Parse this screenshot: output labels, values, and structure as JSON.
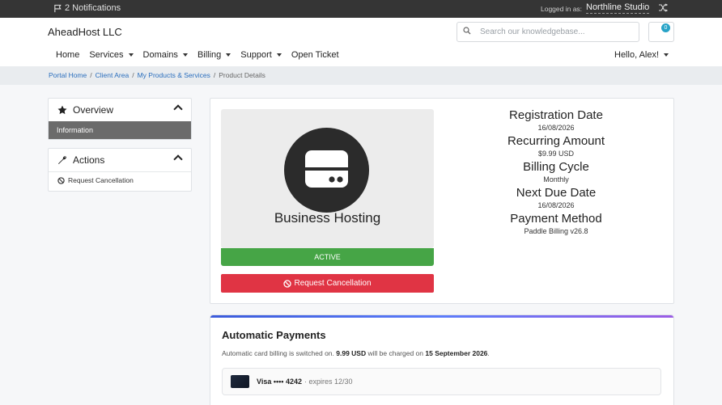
{
  "topbar": {
    "notifications": "2 Notifications",
    "logged_in_label": "Logged in as:",
    "client_name": "Northline Studio"
  },
  "header": {
    "brand": "AheadHost LLC",
    "search_placeholder": "Search our knowledgebase...",
    "cart_count": "0",
    "nav": [
      {
        "label": "Home",
        "caret": false
      },
      {
        "label": "Services",
        "caret": true
      },
      {
        "label": "Domains",
        "caret": true
      },
      {
        "label": "Billing",
        "caret": true
      },
      {
        "label": "Support",
        "caret": true
      },
      {
        "label": "Open Ticket",
        "caret": false
      }
    ],
    "greeting": "Hello, Alex!"
  },
  "breadcrumb": {
    "items": [
      "Portal Home",
      "Client Area",
      "My Products & Services"
    ],
    "current": "Product Details"
  },
  "sidebar": {
    "overview": {
      "title": "Overview",
      "items": [
        "Information"
      ]
    },
    "actions": {
      "title": "Actions",
      "items": [
        "Request Cancellation"
      ]
    }
  },
  "product": {
    "name": "Business Hosting",
    "status": "ACTIVE",
    "cancel_label": "Request Cancellation",
    "details": [
      {
        "label": "Registration Date",
        "value": "16/08/2026"
      },
      {
        "label": "Recurring Amount",
        "value": "$9.99 USD"
      },
      {
        "label": "Billing Cycle",
        "value": "Monthly"
      },
      {
        "label": "Next Due Date",
        "value": "16/08/2026"
      },
      {
        "label": "Payment Method",
        "value": "Paddle Billing v26.8"
      }
    ]
  },
  "auto_payments": {
    "title": "Automatic Payments",
    "desc_pre": "Automatic card billing is switched on. ",
    "amount": "9.99 USD",
    "desc_mid": " will be charged on ",
    "date": "15 September 2026",
    "desc_post": ".",
    "card_label": "Visa •••• 4242",
    "card_expiry": "· expires 12/30"
  },
  "colors": {
    "topbar": "#353535",
    "active_status": "#46a546",
    "cancel": "#e03444",
    "link": "#2a6ebd"
  }
}
